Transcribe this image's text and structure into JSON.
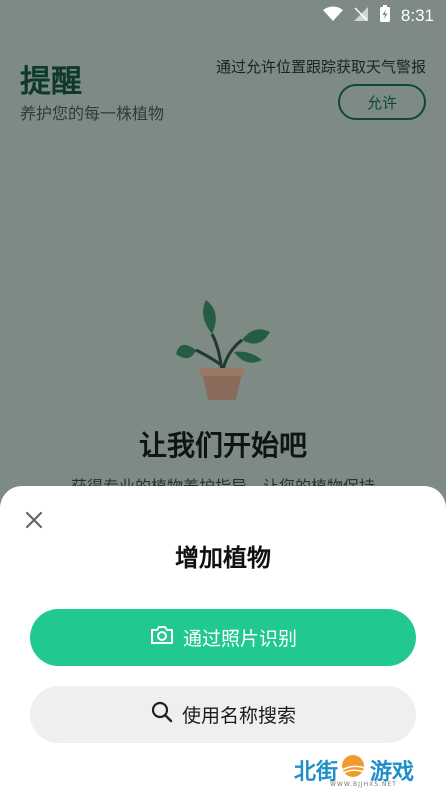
{
  "status_bar": {
    "time": "8:31",
    "icons": [
      "wifi-icon",
      "signal-icon",
      "battery-icon"
    ]
  },
  "header": {
    "title": "提醒",
    "subtitle": "养护您的每一株植物",
    "weather_note": "通过允许位置跟踪获取天气警报",
    "allow_button": "允许"
  },
  "empty_state": {
    "title": "让我们开始吧",
    "description": "获得专业的植物养护指导，让您的植物保持"
  },
  "sheet": {
    "title": "增加植物",
    "photo_button": "通过照片识别",
    "search_button": "使用名称搜索"
  },
  "watermark": {
    "left": "北街",
    "right": "游戏",
    "sub": "WWW.BJJHXS.NET"
  },
  "colors": {
    "primary": "#22c98e",
    "overlay": "#7e8a84",
    "dark_green": "#0d3a2a"
  }
}
